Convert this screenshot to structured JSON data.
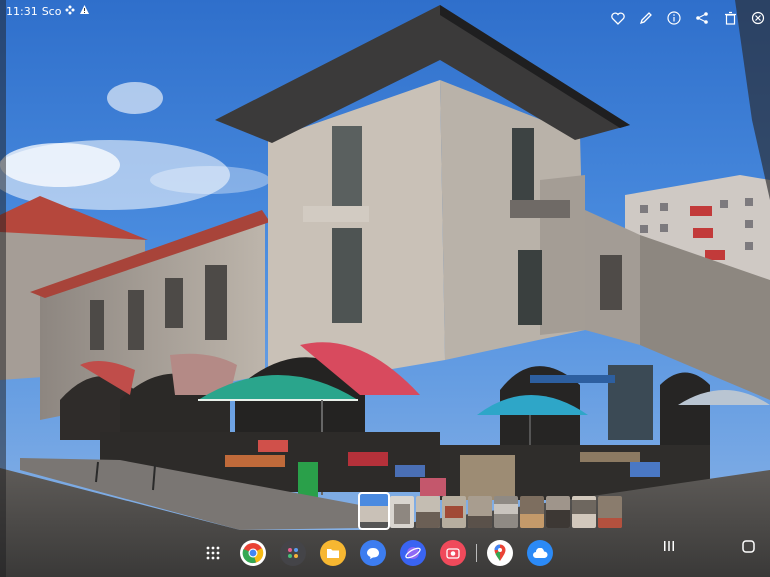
{
  "status_bar": {
    "time": "11:31",
    "carrier": "Sco",
    "icons": [
      "signal-icon",
      "dots-icon",
      "wifi-icon",
      "warning-icon"
    ]
  },
  "viewer": {
    "photo_subject": "market-building-photo",
    "toolbar": [
      "heart-icon",
      "edit-icon",
      "info-icon",
      "share-icon",
      "delete-icon",
      "more-icon"
    ]
  },
  "filmstrip": {
    "thumbnail_count": 10,
    "active_index": 0
  },
  "dock": {
    "apps": [
      {
        "icon": "app-drawer-icon",
        "color": "#5a5a5e"
      },
      {
        "icon": "chrome-icon",
        "color": "#ffffff"
      },
      {
        "icon": "folder-grid-icon",
        "color": "#444448"
      },
      {
        "icon": "my-files-icon",
        "color": "#f7b731"
      },
      {
        "icon": "messages-icon",
        "color": "#3d7df0"
      },
      {
        "icon": "internet-browser-icon",
        "color": "#3a64f2"
      },
      {
        "icon": "screen-recorder-icon",
        "color": "#f04a5b"
      },
      {
        "icon": "maps-icon",
        "color": "#ffffff"
      },
      {
        "icon": "cloud-icon",
        "color": "#2b8af7"
      }
    ]
  },
  "nav": [
    "recents-icon",
    "home-icon"
  ]
}
